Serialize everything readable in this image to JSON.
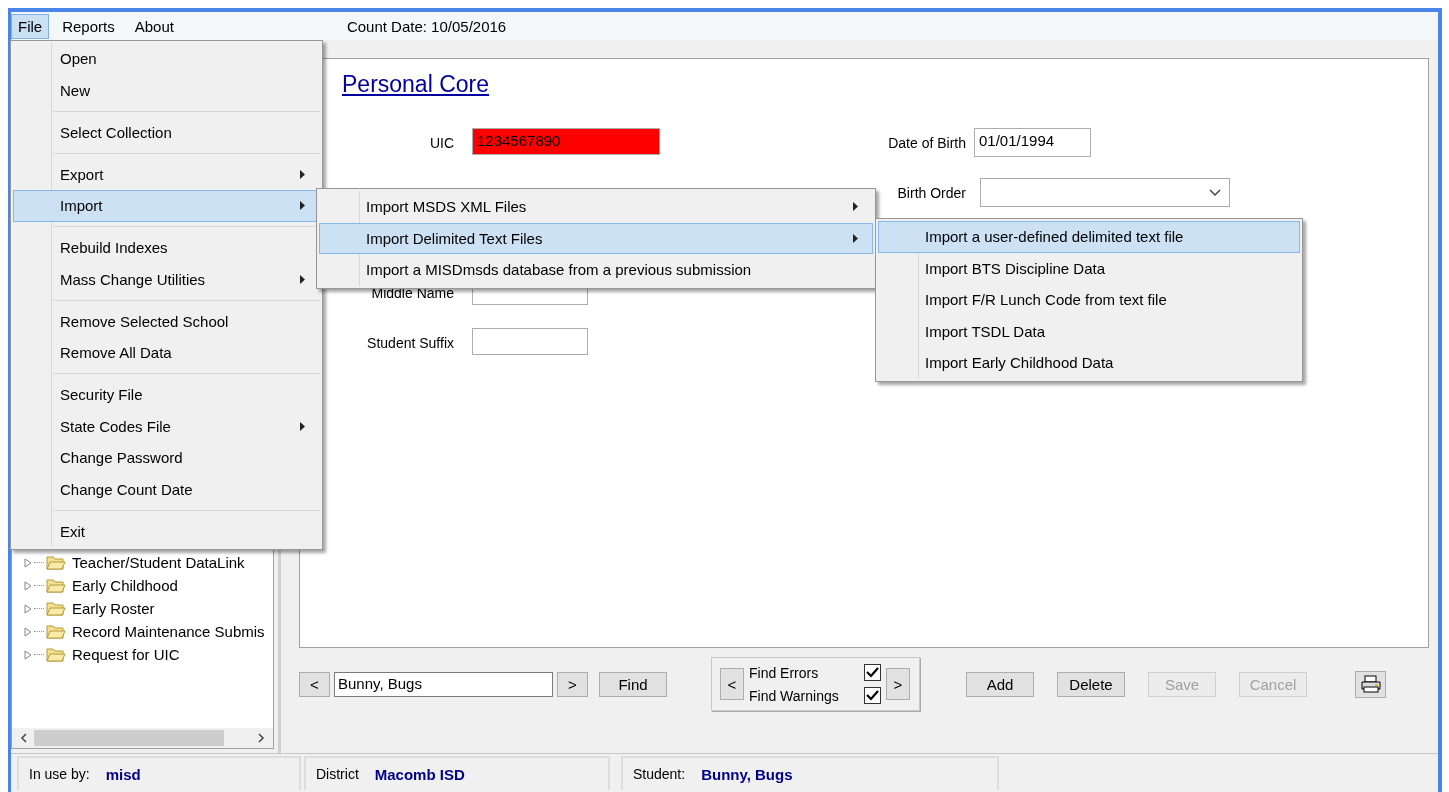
{
  "menu_bar": {
    "items": [
      {
        "label": "File",
        "selected": true
      },
      {
        "label": "Reports",
        "selected": false
      },
      {
        "label": "About",
        "selected": false
      }
    ],
    "count_date": "Count Date: 10/05/2016"
  },
  "file_menu": {
    "groups": [
      [
        {
          "label": "Open",
          "submenu": false,
          "selected": false
        },
        {
          "label": "New",
          "submenu": false,
          "selected": false
        }
      ],
      [
        {
          "label": "Select Collection",
          "submenu": false,
          "selected": false
        }
      ],
      [
        {
          "label": "Export",
          "submenu": true,
          "selected": false
        },
        {
          "label": "Import",
          "submenu": true,
          "selected": true
        }
      ],
      [
        {
          "label": "Rebuild Indexes",
          "submenu": false,
          "selected": false
        },
        {
          "label": "Mass Change Utilities",
          "submenu": true,
          "selected": false
        }
      ],
      [
        {
          "label": "Remove Selected School",
          "submenu": false,
          "selected": false
        },
        {
          "label": "Remove All Data",
          "submenu": false,
          "selected": false
        }
      ],
      [
        {
          "label": "Security File",
          "submenu": false,
          "selected": false
        },
        {
          "label": "State Codes File",
          "submenu": true,
          "selected": false
        },
        {
          "label": "Change Password",
          "submenu": false,
          "selected": false
        },
        {
          "label": "Change Count Date",
          "submenu": false,
          "selected": false
        }
      ],
      [
        {
          "label": "Exit",
          "submenu": false,
          "selected": false
        }
      ]
    ]
  },
  "import_menu": {
    "items": [
      {
        "label": "Import MSDS XML Files",
        "submenu": true,
        "selected": false
      },
      {
        "label": "Import Delimited Text Files",
        "submenu": true,
        "selected": true
      },
      {
        "label": "Import a MISDmsds database from a previous submission",
        "submenu": false,
        "selected": false
      }
    ]
  },
  "delimited_menu": {
    "items": [
      {
        "label": "Import a user-defined delimited text file",
        "selected": true
      },
      {
        "label": "Import BTS Discipline Data",
        "selected": false
      },
      {
        "label": "Import F/R Lunch Code from text file",
        "selected": false
      },
      {
        "label": "Import TSDL Data",
        "selected": false
      },
      {
        "label": "Import Early Childhood Data",
        "selected": false
      }
    ]
  },
  "tree": {
    "items": [
      {
        "label": "Teacher/Student DataLink"
      },
      {
        "label": "Early Childhood"
      },
      {
        "label": "Early Roster"
      },
      {
        "label": "Record Maintenance Submis"
      },
      {
        "label": "Request for UIC"
      }
    ]
  },
  "form": {
    "title": "Personal Core",
    "left_fields": [
      {
        "label": "UIC",
        "value": "1234567890",
        "error": true
      },
      {
        "label": "Middle Name",
        "error": false
      },
      {
        "label": "Student Suffix",
        "error": false
      }
    ],
    "right_fields": [
      {
        "kind": "text",
        "label": "Date of Birth",
        "value": "01/01/1994"
      },
      {
        "kind": "select",
        "label": "Birth Order"
      }
    ]
  },
  "toolbar": {
    "prev": "<",
    "search_value": "Bunny, Bugs",
    "next": ">",
    "find": "Find",
    "find_group": {
      "prev": "<",
      "next": ">",
      "options": [
        {
          "label": "Find Errors",
          "checked": true
        },
        {
          "label": "Find Warnings",
          "checked": true
        }
      ]
    },
    "buttons": [
      {
        "label": "Add",
        "disabled": false
      },
      {
        "label": "Delete",
        "disabled": false
      },
      {
        "label": "Save",
        "disabled": true
      },
      {
        "label": "Cancel",
        "disabled": true
      }
    ]
  },
  "status_bar": [
    {
      "label": "In use by:",
      "value": "misd"
    },
    {
      "label": "District",
      "value": "Macomb ISD"
    },
    {
      "label": "Student:",
      "value": "Bunny, Bugs"
    }
  ]
}
